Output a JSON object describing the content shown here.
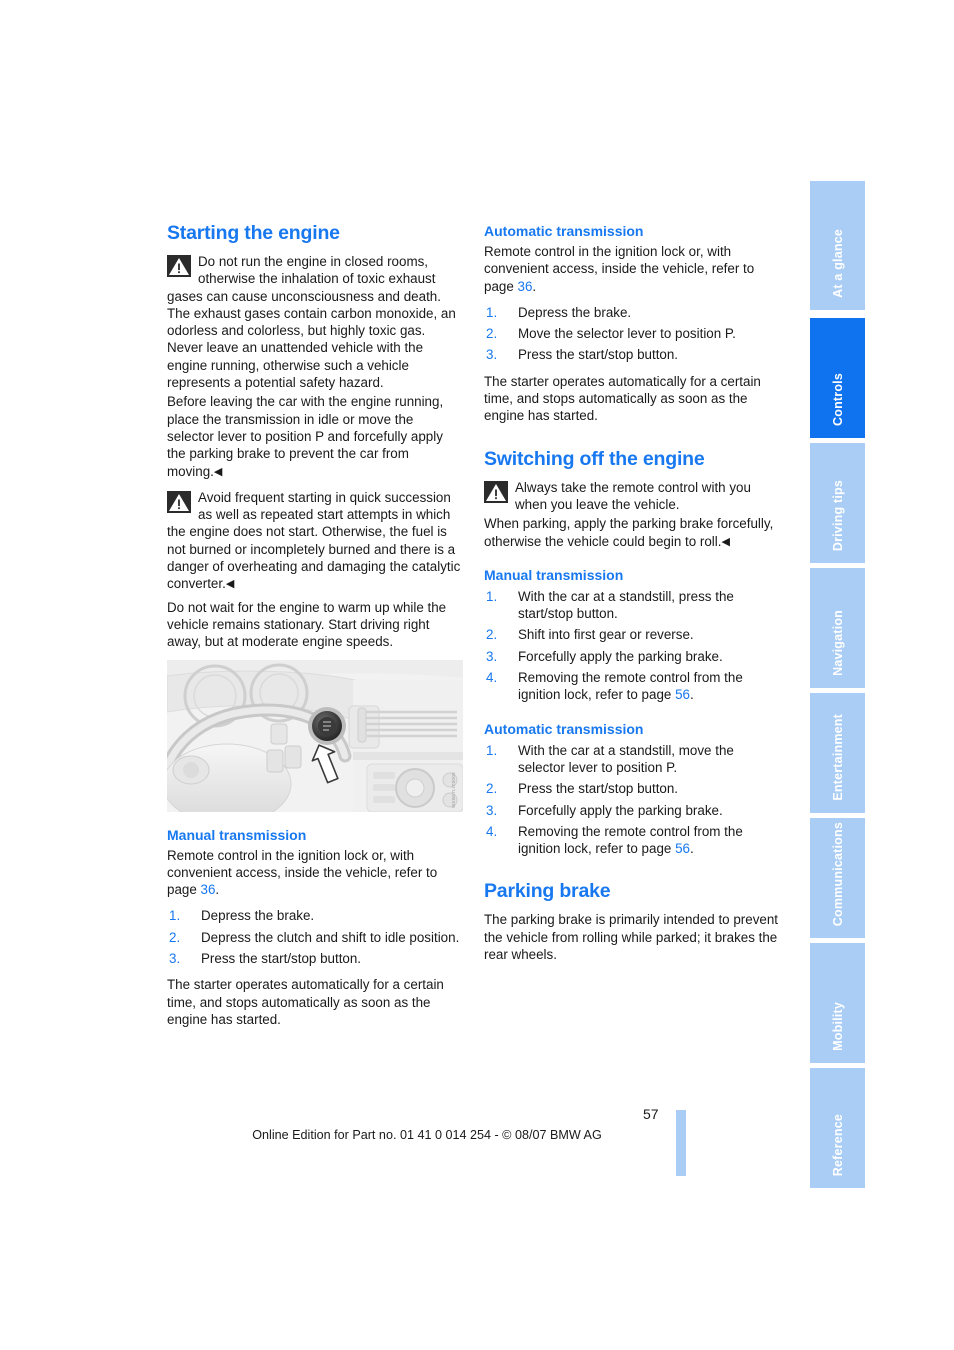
{
  "document": {
    "page_number": "57",
    "footer_text": "Online Edition for Part no. 01 41 0 014 254 - © 08/07 BMW AG"
  },
  "colors": {
    "heading_blue": "#1878f0",
    "tab_inactive": "#aacdf5",
    "tab_active": "#0f72ee",
    "body_text": "#1a1a1a"
  },
  "tabs": [
    {
      "label": "At a glance",
      "active": false
    },
    {
      "label": "Controls",
      "active": true
    },
    {
      "label": "Driving tips",
      "active": false
    },
    {
      "label": "Navigation",
      "active": false
    },
    {
      "label": "Entertainment",
      "active": false
    },
    {
      "label": "Communications",
      "active": false
    },
    {
      "label": "Mobility",
      "active": false
    },
    {
      "label": "Reference",
      "active": false
    }
  ],
  "left_column": {
    "heading": "Starting the engine",
    "warning_1": "Do not run the engine in closed rooms, otherwise the inhalation of toxic exhaust gases can cause unconsciousness and death. The exhaust gases contain carbon monoxide, an odorless and colorless, but highly toxic gas. Never leave an unattended vehicle with the engine running, otherwise such a vehicle represents a potential safety hazard.",
    "warning_1b": "Before leaving the car with the engine running, place the transmission in idle or move the selector lever to position P and forcefully apply the parking brake to prevent the car from moving.",
    "warning_2": "Avoid frequent starting in quick succession as well as repeated start attempts in which the engine does not start. Otherwise, the fuel is not burned or incompletely burned and there is a danger of overheating and damaging the catalytic converter.",
    "paragraph_1": "Do not wait for the engine to warm up while the vehicle remains stationary. Start driving right away, but at moderate engine speeds.",
    "figure_caption": "WKB57LIT0005",
    "manual": {
      "heading": "Manual transmission",
      "intro_before": "Remote control in the ignition lock or, with convenient access, inside the vehicle, refer to page ",
      "intro_pageref": "36",
      "intro_after": ".",
      "steps": [
        "Depress the brake.",
        "Depress the clutch and shift to idle position.",
        "Press the start/stop button."
      ],
      "tail": "The starter operates automatically for a certain time, and stops automatically as soon as the engine has started."
    }
  },
  "right_column": {
    "automatic_start": {
      "heading": "Automatic transmission",
      "intro_before": "Remote control in the ignition lock or, with convenient access, inside the vehicle, refer to page ",
      "intro_pageref": "36",
      "intro_after": ".",
      "steps": [
        "Depress the brake.",
        "Move the selector lever to position P.",
        "Press the start/stop button."
      ],
      "tail": "The starter operates automatically for a certain time, and stops automatically as soon as the engine has started."
    },
    "switching_off": {
      "heading": "Switching off the engine",
      "warning": "Always take the remote control with you when you leave the vehicle.",
      "warning_b": "When parking, apply the parking brake forcefully, otherwise the vehicle could begin to roll.",
      "manual": {
        "heading": "Manual transmission",
        "steps": [
          "With the car at a standstill, press the start/stop button.",
          "Shift into first gear or reverse.",
          "Forcefully apply the parking brake.",
          "Removing the remote control from the ignition lock, refer to page "
        ],
        "step4_pageref": "56",
        "step4_after": "."
      },
      "automatic": {
        "heading": "Automatic transmission",
        "steps": [
          "With the car at a standstill, move the selector lever to position P.",
          "Press the start/stop button.",
          "Forcefully apply the parking brake.",
          "Removing the remote control from the ignition lock, refer to page "
        ],
        "step4_pageref": "56",
        "step4_after": "."
      }
    },
    "parking_brake": {
      "heading": "Parking brake",
      "paragraph": "The parking brake is primarily intended to prevent the vehicle from rolling while parked; it brakes the rear wheels."
    }
  },
  "numbers": {
    "n1": "1.",
    "n2": "2.",
    "n3": "3.",
    "n4": "4."
  }
}
